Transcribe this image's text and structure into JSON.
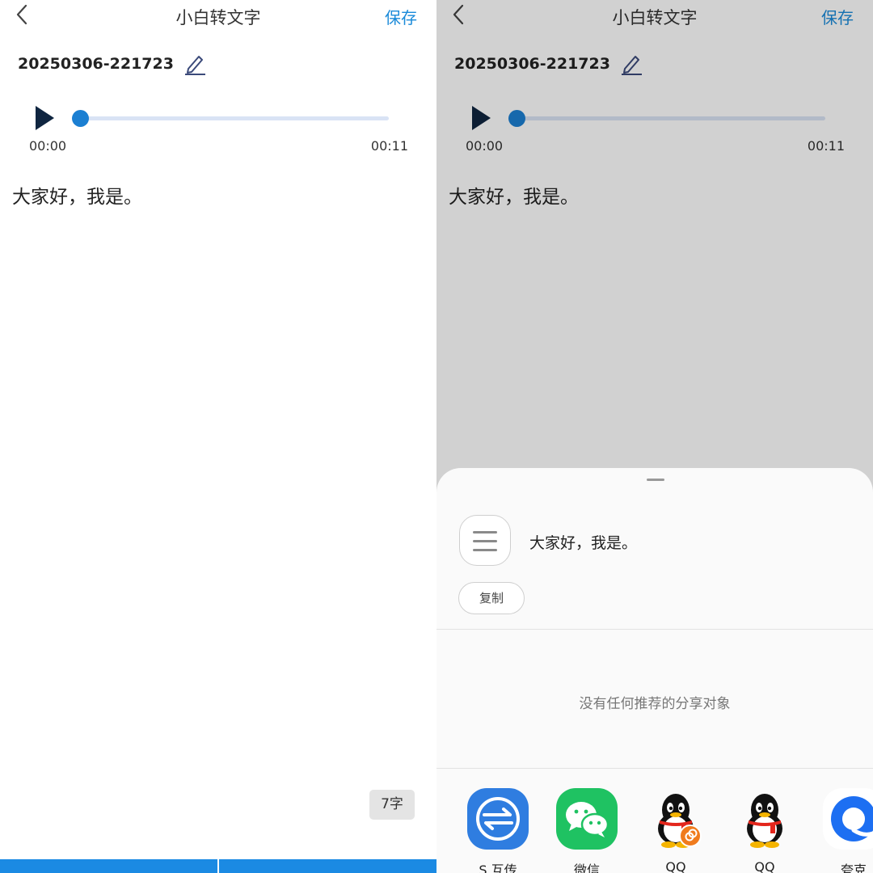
{
  "colors": {
    "accent": "#1a8ad9",
    "progress_knob": "#1b7fd2",
    "progress_track": "#d9e3f5",
    "bottom_bar": "#1b8ae3",
    "wechat_green": "#1fc262",
    "s_transfer_blue": "#2f7de0",
    "dark_icon": "#0f2540"
  },
  "left": {
    "header": {
      "title": "小白转文字",
      "save_label": "保存",
      "back_icon": "chevron-left-icon"
    },
    "file": {
      "name": "20250306-221723",
      "edit_icon": "pencil-icon"
    },
    "player": {
      "play_icon": "play-icon",
      "current_time": "00:00",
      "total_time": "00:11",
      "progress": 0
    },
    "transcript": "大家好，我是。",
    "char_count": "7字"
  },
  "right": {
    "header": {
      "title": "小白转文字",
      "save_label": "保存",
      "back_icon": "chevron-left-icon"
    },
    "file": {
      "name": "20250306-221723",
      "edit_icon": "pencil-icon"
    },
    "player": {
      "play_icon": "play-icon",
      "current_time": "00:00",
      "total_time": "00:11",
      "progress": 0
    },
    "transcript": "大家好，我是。",
    "share_sheet": {
      "preview_text": "大家好，我是。",
      "preview_icon": "document-lines-icon",
      "copy_label": "复制",
      "empty_message": "没有任何推荐的分享对象",
      "apps": [
        {
          "label": "S 互传",
          "icon": "s-transfer-icon"
        },
        {
          "label": "微信",
          "icon": "wechat-icon"
        },
        {
          "label": "QQ",
          "icon": "qq-icon"
        },
        {
          "label": "QQ",
          "icon": "qq-icon"
        },
        {
          "label": "夸克",
          "icon": "quark-icon"
        }
      ]
    }
  }
}
